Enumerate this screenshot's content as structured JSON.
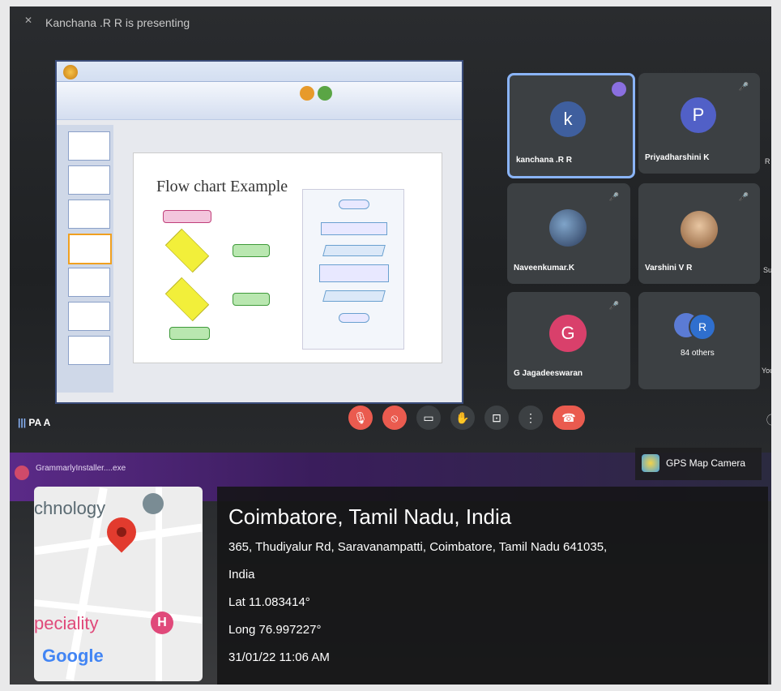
{
  "meeting": {
    "presenting_label": "Kanchana .R R is presenting",
    "self_label": "PA A",
    "self_icon": "audio-bars-icon"
  },
  "slide": {
    "title": "Flow chart Example"
  },
  "participants": [
    {
      "name": "kanchana .R R",
      "initial": "k",
      "color": "#3f5f9e",
      "active": true
    },
    {
      "name": "Priyadharshini K",
      "initial": "P",
      "color": "#5160c7",
      "muted": true
    },
    {
      "name": "Naveenkumar.K",
      "muted": true
    },
    {
      "name": "Varshini V R",
      "muted": true
    },
    {
      "name": "G Jagadeeswaran",
      "initial": "G",
      "color": "#d9406b",
      "muted": true
    },
    {
      "name": "84 others",
      "initial": "R"
    }
  ],
  "edge_letters": [
    "R",
    "Su",
    "You"
  ],
  "controls": [
    {
      "name": "mic-off-icon",
      "color": "#ea5b4f"
    },
    {
      "name": "camera-off-icon",
      "color": "#ea5b4f"
    },
    {
      "name": "captions-icon",
      "color": "#3c4043"
    },
    {
      "name": "raise-hand-icon",
      "color": "#3c4043"
    },
    {
      "name": "present-icon",
      "color": "#3c4043"
    },
    {
      "name": "more-options-icon",
      "color": "#3c4043"
    },
    {
      "name": "end-call-icon",
      "color": "#ea5b4f"
    }
  ],
  "taskbar": {
    "download_label": "GrammarlyInstaller....exe"
  },
  "gps": {
    "app_name": "GPS Map Camera",
    "city": "Coimbatore, Tamil Nadu, India",
    "address_line1": "365, Thudiyalur Rd, Saravanampatti, Coimbatore, Tamil Nadu 641035,",
    "address_line2": "India",
    "lat": "Lat 11.083414°",
    "long": "Long 76.997227°",
    "datetime": "31/01/22 11:06 AM"
  },
  "map": {
    "label_top": "chnology",
    "label_bottom": "peciality",
    "google_logo": "Google",
    "pin_color": "#e23b2e"
  }
}
